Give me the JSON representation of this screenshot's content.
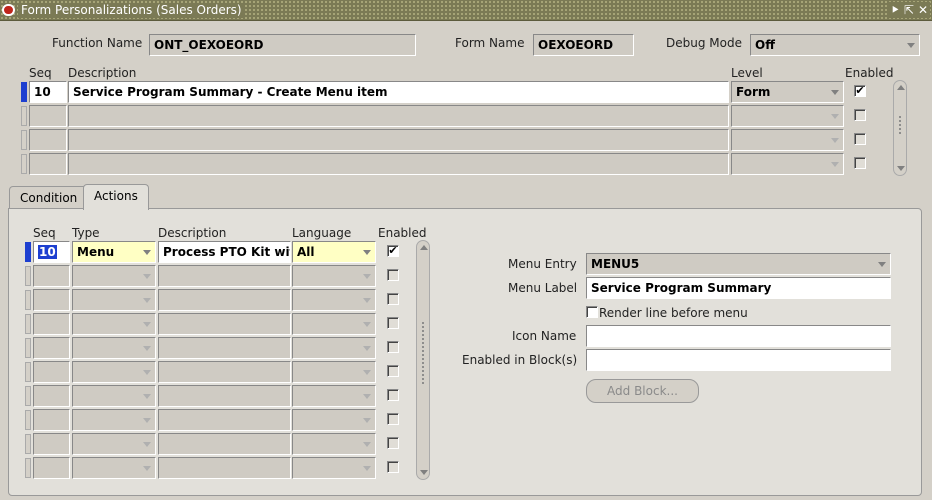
{
  "window": {
    "title": "Form Personalizations (Sales Orders)",
    "controls": [
      "⯈",
      "⇱",
      "✕"
    ]
  },
  "header": {
    "function_name_label": "Function Name",
    "function_name_value": "ONT_OEXOEORD",
    "form_name_label": "Form Name",
    "form_name_value": "OEXOEORD",
    "debug_mode_label": "Debug Mode",
    "debug_mode_value": "Off"
  },
  "rules": {
    "columns": {
      "seq": "Seq",
      "description": "Description",
      "level": "Level",
      "enabled": "Enabled"
    },
    "rows": [
      {
        "seq": "10",
        "description": "Service Program Summary - Create Menu item",
        "level": "Form",
        "enabled": "✔"
      },
      {
        "seq": "",
        "description": "",
        "level": "",
        "enabled": ""
      },
      {
        "seq": "",
        "description": "",
        "level": "",
        "enabled": ""
      },
      {
        "seq": "",
        "description": "",
        "level": "",
        "enabled": ""
      }
    ]
  },
  "tabs": {
    "condition": "Condition",
    "actions": "Actions"
  },
  "actions": {
    "columns": {
      "seq": "Seq",
      "type": "Type",
      "description": "Description",
      "language": "Language",
      "enabled": "Enabled"
    },
    "rows": [
      {
        "seq": "10",
        "type": "Menu",
        "description": "Process PTO Kit with",
        "language": "All",
        "enabled": "✔"
      },
      {
        "seq": "",
        "type": "",
        "description": "",
        "language": "",
        "enabled": ""
      },
      {
        "seq": "",
        "type": "",
        "description": "",
        "language": "",
        "enabled": ""
      },
      {
        "seq": "",
        "type": "",
        "description": "",
        "language": "",
        "enabled": ""
      },
      {
        "seq": "",
        "type": "",
        "description": "",
        "language": "",
        "enabled": ""
      },
      {
        "seq": "",
        "type": "",
        "description": "",
        "language": "",
        "enabled": ""
      },
      {
        "seq": "",
        "type": "",
        "description": "",
        "language": "",
        "enabled": ""
      },
      {
        "seq": "",
        "type": "",
        "description": "",
        "language": "",
        "enabled": ""
      },
      {
        "seq": "",
        "type": "",
        "description": "",
        "language": "",
        "enabled": ""
      },
      {
        "seq": "",
        "type": "",
        "description": "",
        "language": "",
        "enabled": ""
      }
    ]
  },
  "menu_details": {
    "menu_entry_label": "Menu Entry",
    "menu_entry_value": "MENU5",
    "menu_label_label": "Menu Label",
    "menu_label_value": "Service Program Summary",
    "render_line_label": "Render line before menu",
    "icon_name_label": "Icon Name",
    "icon_name_value": "",
    "enabled_blocks_label": "Enabled in Block(s)",
    "enabled_blocks_value": "",
    "add_block_label": "Add Block..."
  }
}
